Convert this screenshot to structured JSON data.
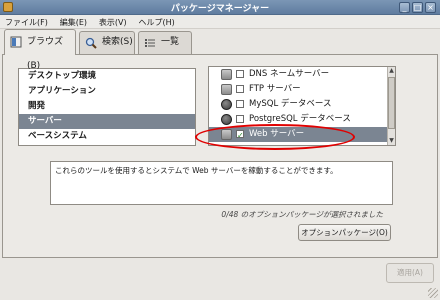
{
  "window": {
    "title": "パッケージマネージャー",
    "controls": [
      "_",
      "□",
      "×"
    ]
  },
  "menu": [
    {
      "label": "ファイル(F)"
    },
    {
      "label": "編集(E)"
    },
    {
      "label": "表示(V)"
    },
    {
      "label": "ヘルプ(H)"
    }
  ],
  "tabs": [
    {
      "label": "ブラウズ(B)",
      "icon": "browse-icon"
    },
    {
      "label": "検索(S)",
      "icon": "search-icon"
    },
    {
      "label": "一覧(L)",
      "icon": "list-icon"
    }
  ],
  "categories": [
    {
      "label": "デスクトップ環境"
    },
    {
      "label": "アプリケーション"
    },
    {
      "label": "開発"
    },
    {
      "label": "サーバー"
    },
    {
      "label": "ベースシステム"
    }
  ],
  "groups": [
    {
      "label": "DNS ネームサーバー",
      "icon": "server"
    },
    {
      "label": "FTP サーバー",
      "icon": "server"
    },
    {
      "label": "MySQL データベース",
      "icon": "db"
    },
    {
      "label": "PostgreSQL データベース",
      "icon": "db"
    },
    {
      "label": "Web サーバー",
      "icon": "server"
    }
  ],
  "description": "これらのツールを使用するとシステムで Web サーバーを稼動することができます。",
  "status": "0/48 のオプションパッケージが選択されました",
  "buttons": {
    "optional_packages": "オプションパッケージ(O)",
    "apply": "適用(A)"
  }
}
